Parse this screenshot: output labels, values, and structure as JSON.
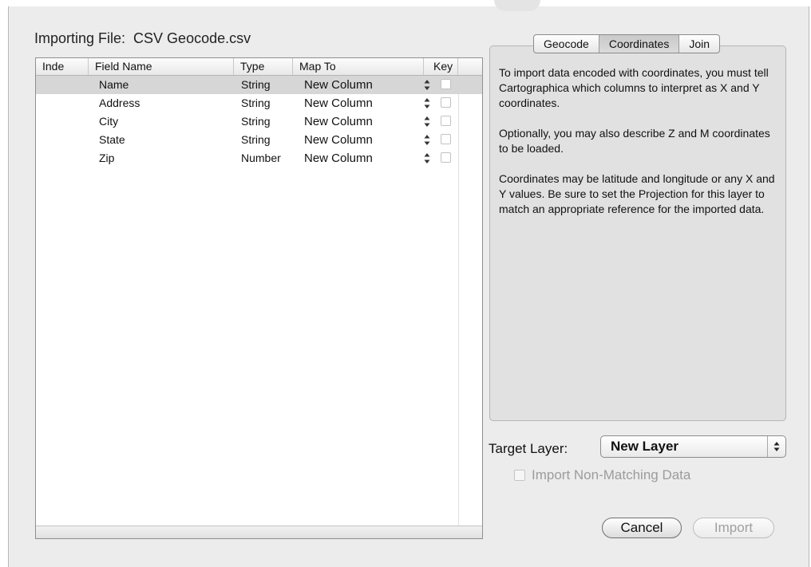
{
  "title": {
    "label": "Importing File:",
    "filename": "CSV Geocode.csv"
  },
  "table": {
    "columns": [
      "Inde",
      "Field Name",
      "Type",
      "Map To",
      "Key"
    ],
    "rows": [
      {
        "name": "Name",
        "type": "String",
        "map_to": "New Column",
        "selected": true
      },
      {
        "name": "Address",
        "type": "String",
        "map_to": "New Column"
      },
      {
        "name": "City",
        "type": "String",
        "map_to": "New Column"
      },
      {
        "name": "State",
        "type": "String",
        "map_to": "New Column"
      },
      {
        "name": "Zip",
        "type": "Number",
        "map_to": "New Column"
      }
    ]
  },
  "tabs": {
    "items": [
      "Geocode",
      "Coordinates",
      "Join"
    ],
    "active": "Coordinates"
  },
  "panel": {
    "paragraphs": [
      "To import data encoded with coordinates, you must tell Cartographica which columns to interpret as X and Y coordinates.",
      "Optionally, you may also describe Z and M coordinates to be loaded.",
      "Coordinates may be latitude and longitude or any X and Y values.  Be sure to set the Projection for this layer to match an appropriate reference for the imported data."
    ]
  },
  "target_layer": {
    "label": "Target Layer:",
    "value": "New Layer"
  },
  "non_matching": {
    "label": "Import Non-Matching Data",
    "checked": false,
    "enabled": false
  },
  "buttons": {
    "cancel": "Cancel",
    "import": "Import"
  }
}
